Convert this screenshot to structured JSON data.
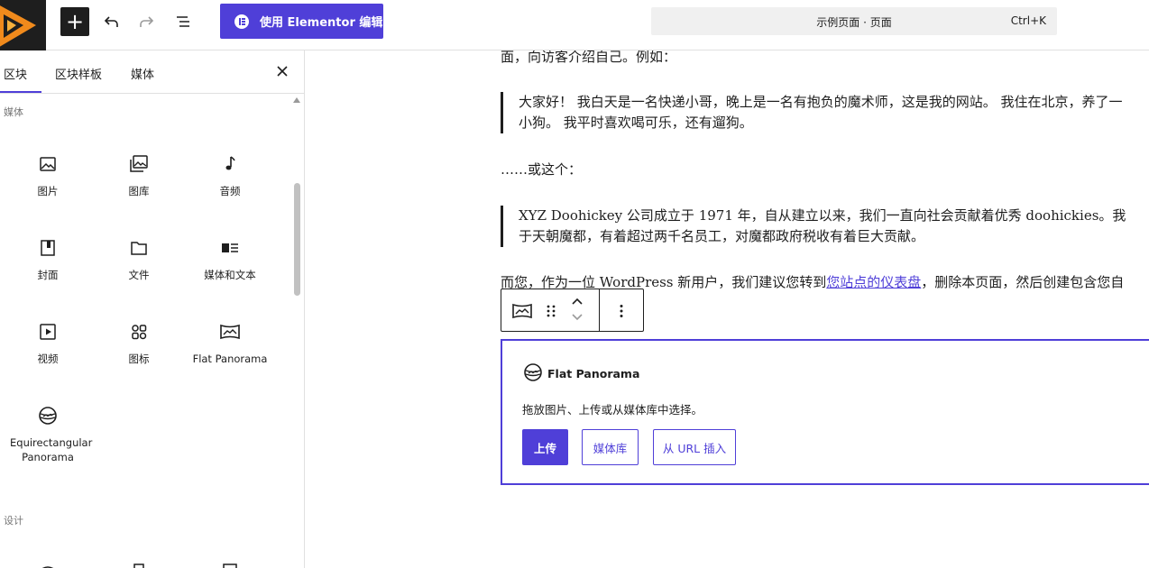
{
  "topbar": {
    "logo": "site-logo-icon",
    "add_label": "+",
    "elementor_label": "使用 Elementor 编辑",
    "command_title": "示例页面 · 页面",
    "command_shortcut": "Ctrl+K"
  },
  "sidebar": {
    "tabs": [
      {
        "label": "区块",
        "active": true
      },
      {
        "label": "区块样板",
        "active": false
      },
      {
        "label": "媒体",
        "active": false
      }
    ],
    "sections": {
      "media": "媒体",
      "design": "设计"
    },
    "media_blocks": [
      {
        "label": "图片",
        "icon": "image-icon"
      },
      {
        "label": "图库",
        "icon": "gallery-icon"
      },
      {
        "label": "音频",
        "icon": "audio-icon"
      },
      {
        "label": "封面",
        "icon": "cover-icon"
      },
      {
        "label": "文件",
        "icon": "file-icon"
      },
      {
        "label": "媒体和文本",
        "icon": "media-text-icon"
      },
      {
        "label": "视频",
        "icon": "video-icon"
      },
      {
        "label": "图标",
        "icon": "icons-icon"
      },
      {
        "label": "Flat Panorama",
        "icon": "flat-panorama-icon"
      },
      {
        "label": "Equirectangular Panorama",
        "icon": "equirectangular-panorama-icon"
      }
    ]
  },
  "content": {
    "intro": "面，向访客介绍自己。例如：",
    "quote1_line1": "大家好！ 我白天是一名快递小哥，晚上是一名有抱负的魔术师，这是我的网站。 我住在北京，养了一",
    "quote1_line2": "小狗。 我平时喜欢喝可乐，还有遛狗。",
    "or_this": "……或这个：",
    "quote2_line1": "XYZ Doohickey 公司成立于 1971 年，自从建立以来，我们一直向社会贡献着优秀 doohickies。我",
    "quote2_line2": "于天朝魔都，有着超过两千名员工，对魔都政府税收有着巨大贡献。",
    "closing_before": "而您，作为一位 WordPress 新用户，我们建议您转到",
    "closing_link": "您站点的仪表盘",
    "closing_after": "，删除本页面，然后创建包含您自"
  },
  "placeholder": {
    "title": "Flat Panorama",
    "instructions": "拖放图片、上传或从媒体库中选择。",
    "upload_label": "上传",
    "media_library_label": "媒体库",
    "insert_url_label": "从 URL 插入"
  },
  "colors": {
    "accent": "#4f3fd8",
    "logo_orange": "#f08a1c",
    "dark": "#1e1e1e"
  }
}
